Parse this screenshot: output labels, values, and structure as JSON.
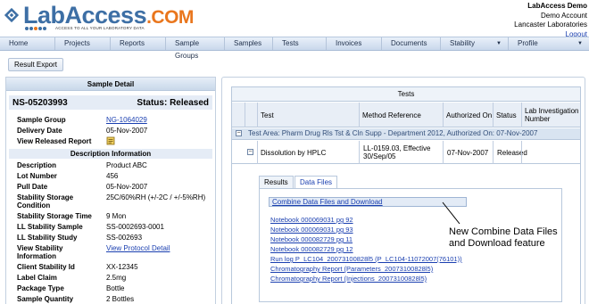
{
  "brand": {
    "name_main": "LabAccess",
    "name_suffix": ".COM",
    "tagline": "ACCESS TO ALL YOUR LABORATORY DATA"
  },
  "user": {
    "name": "LabAccess Demo",
    "account": "Demo Account",
    "company": "Lancaster Laboratories",
    "logout_label": "Logout"
  },
  "nav": [
    {
      "label": "Home",
      "dropdown": false
    },
    {
      "label": "Projects",
      "dropdown": false
    },
    {
      "label": "Reports",
      "dropdown": false
    },
    {
      "label": "Sample Groups",
      "dropdown": false
    },
    {
      "label": "Samples",
      "dropdown": false
    },
    {
      "label": "Tests",
      "dropdown": false
    },
    {
      "label": "Invoices",
      "dropdown": false
    },
    {
      "label": "Documents",
      "dropdown": false
    },
    {
      "label": "Stability",
      "dropdown": true
    },
    {
      "label": "Profile",
      "dropdown": true
    }
  ],
  "toolbar": {
    "export_label": "Result Export"
  },
  "sample_detail": {
    "panel_title": "Sample Detail",
    "sample_id": "NS-05203993",
    "status": "Status: Released",
    "fields_top": [
      {
        "label": "Sample Group",
        "value": "NG-1064029",
        "link": true
      },
      {
        "label": "Delivery Date",
        "value": "05-Nov-2007",
        "link": false
      },
      {
        "label": "View Released Report",
        "value": "",
        "icon": "report-icon"
      }
    ],
    "description_header": "Description Information",
    "fields_desc": [
      {
        "label": "Description",
        "value": "Product ABC",
        "link": false
      },
      {
        "label": "Lot Number",
        "value": "456",
        "link": false
      },
      {
        "label": "Pull Date",
        "value": "05-Nov-2007",
        "link": false
      },
      {
        "label": "Stability Storage Condition",
        "value": "25C/60%RH (+/-2C / +/-5%RH)",
        "link": false
      },
      {
        "label": "Stability Storage Time",
        "value": "9 Mon",
        "link": false
      },
      {
        "label": "LL Stability Sample",
        "value": "SS-0002693-0001",
        "link": false
      },
      {
        "label": "LL Stability Study",
        "value": "SS-002693",
        "link": false
      },
      {
        "label": "View Stability Information",
        "value": "View Protocol Detail",
        "link": true
      },
      {
        "label": "Client Stability Id",
        "value": "XX-12345",
        "link": false
      },
      {
        "label": "Label Claim",
        "value": "2.5mg",
        "link": false
      },
      {
        "label": "Package Type",
        "value": "Bottle",
        "link": false
      },
      {
        "label": "Sample Quantity",
        "value": "2 Bottles",
        "link": false
      }
    ]
  },
  "tests": {
    "title": "Tests",
    "columns": [
      "Test",
      "Method Reference",
      "Authorized On",
      "Status",
      "Lab Investigation Number"
    ],
    "group_label": "Test Area: Pharm Drug Rls Tst & Cln Supp - Department 2012, Authorized On: 07-Nov-2007",
    "row": {
      "test": "Dissolution by HPLC",
      "method": "LL-0159.03, Effective 30/Sep/05",
      "authorized_on": "07-Nov-2007",
      "status": "Released",
      "lab_investigation": ""
    },
    "tabs": [
      {
        "label": "Results",
        "active": false
      },
      {
        "label": "Data Files",
        "active": true
      }
    ],
    "combine_label": "Combine Data Files and Download",
    "files": [
      "Notebook 000069031 pg 92",
      "Notebook 000069031 pg 93",
      "Notebook 000082729 pg 11",
      "Notebook 000082729 pg 12",
      "Run log P_LC104_20073100828l5 (P_LC104-11072007(76101))",
      "Chromatography Report (Parameters_20073100828l5)",
      "Chromatography Report (Injections_20073100828l5)"
    ]
  },
  "callout": {
    "line1": "New Combine Data Files",
    "line2": "and Download feature"
  },
  "colors": {
    "brand_blue": "#3d6fa5",
    "brand_orange": "#e9761d",
    "link": "#1a3fb0"
  }
}
